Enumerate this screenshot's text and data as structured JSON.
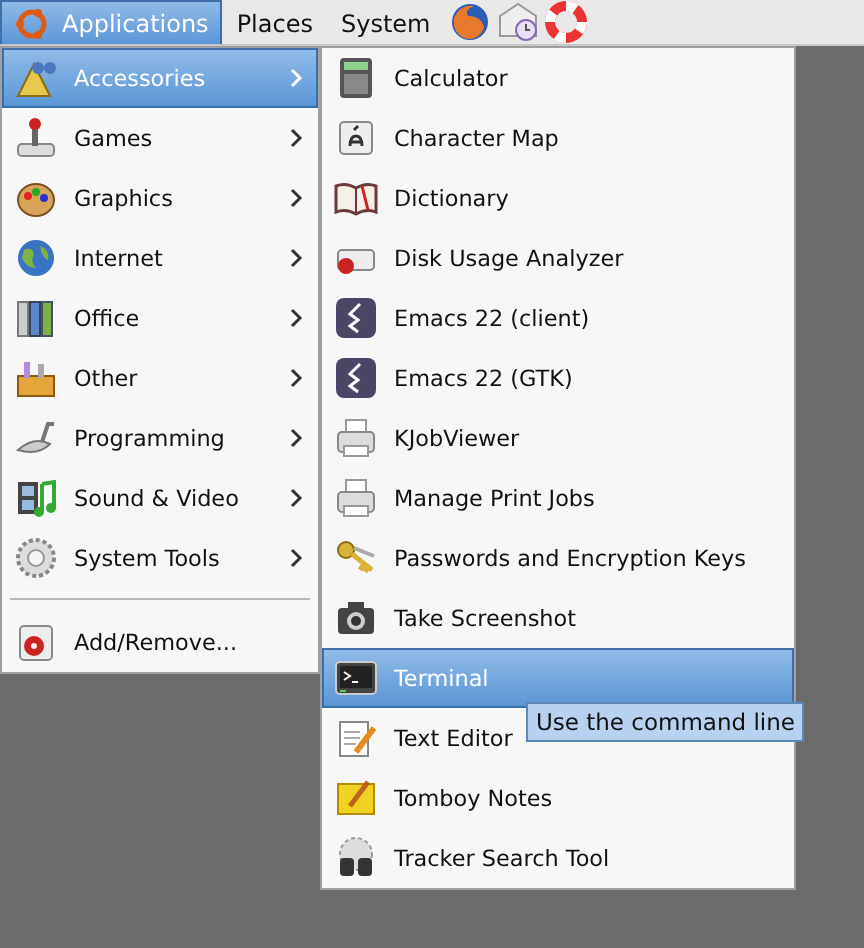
{
  "panel": {
    "items": [
      {
        "label": "Applications",
        "selected": true
      },
      {
        "label": "Places",
        "selected": false
      },
      {
        "label": "System",
        "selected": false
      }
    ]
  },
  "menu": {
    "items": [
      {
        "label": "Accessories",
        "has_submenu": true,
        "selected": true
      },
      {
        "label": "Games",
        "has_submenu": true,
        "selected": false
      },
      {
        "label": "Graphics",
        "has_submenu": true,
        "selected": false
      },
      {
        "label": "Internet",
        "has_submenu": true,
        "selected": false
      },
      {
        "label": "Office",
        "has_submenu": true,
        "selected": false
      },
      {
        "label": "Other",
        "has_submenu": true,
        "selected": false
      },
      {
        "label": "Programming",
        "has_submenu": true,
        "selected": false
      },
      {
        "label": "Sound & Video",
        "has_submenu": true,
        "selected": false
      },
      {
        "label": "System Tools",
        "has_submenu": true,
        "selected": false
      },
      {
        "label": "Add/Remove...",
        "has_submenu": false,
        "selected": false,
        "separator_before": true
      }
    ]
  },
  "submenu": {
    "items": [
      {
        "label": "Calculator",
        "selected": false
      },
      {
        "label": "Character Map",
        "selected": false
      },
      {
        "label": "Dictionary",
        "selected": false
      },
      {
        "label": "Disk Usage Analyzer",
        "selected": false
      },
      {
        "label": "Emacs 22 (client)",
        "selected": false
      },
      {
        "label": "Emacs 22 (GTK)",
        "selected": false
      },
      {
        "label": "KJobViewer",
        "selected": false
      },
      {
        "label": "Manage Print Jobs",
        "selected": false
      },
      {
        "label": "Passwords and Encryption Keys",
        "selected": false
      },
      {
        "label": "Take Screenshot",
        "selected": false
      },
      {
        "label": "Terminal",
        "selected": true
      },
      {
        "label": "Text Editor",
        "selected": false
      },
      {
        "label": "Tomboy Notes",
        "selected": false
      },
      {
        "label": "Tracker Search Tool",
        "selected": false
      }
    ]
  },
  "tooltip": {
    "text": "Use the command line"
  }
}
